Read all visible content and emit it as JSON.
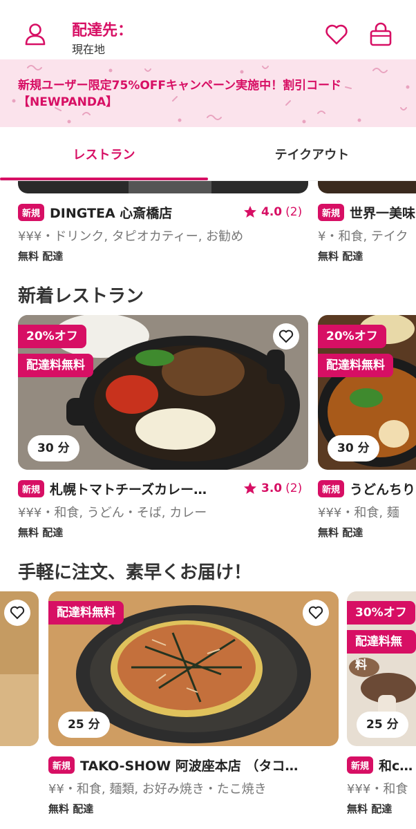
{
  "header": {
    "delivery_label": "配達先：",
    "location": "現在地",
    "icon_profile": "user-icon",
    "icon_favorites": "heart-icon",
    "icon_cart": "bag-icon"
  },
  "banner": {
    "line1": "新規ユーザー限定75%OFFキャンペーン実施中！割引コード",
    "line2": "【NEWPANDA】"
  },
  "tabs": {
    "restaurant": "レストラン",
    "takeout": "テイクアウト"
  },
  "brand_color": "#D70F64",
  "top_row": [
    {
      "new": "新規",
      "name": "DINGTEA 心斎橋店",
      "rating": "4.0",
      "count": "(2)",
      "meta": "¥¥¥・ドリンク, タピオカティー, お勧め",
      "fee": "無料 配達"
    },
    {
      "new": "新規",
      "name": "世界一美味",
      "meta": "¥・和食, テイク",
      "fee": "無料 配達"
    }
  ],
  "section_new": {
    "title": "新着レストラン",
    "cards": [
      {
        "discount": "20%オフ",
        "free_delivery": "配達料無料",
        "time": "30 分",
        "new": "新規",
        "name": "札幌トマトチーズカレー…",
        "rating": "3.0",
        "count": "(2)",
        "meta": "¥¥¥・和食, うどん・そば, カレー",
        "fee": "無料 配達"
      },
      {
        "discount": "20%オフ",
        "free_delivery": "配達料無料",
        "time": "30 分",
        "new": "新規",
        "name": "うどんちり",
        "meta": "¥¥¥・和食, 麺",
        "fee": "無料 配達"
      }
    ]
  },
  "section_quick": {
    "title": "手軽に注文、素早くお届け！",
    "cards": [
      {
        "free_delivery": "配達料無料",
        "time": "25 分",
        "new": "新規",
        "name": "TAKO-SHOW 阿波座本店 （タコ…",
        "meta": "¥¥・和食, 麺類, お好み焼き・たこ焼き",
        "fee": "無料 配達"
      },
      {
        "discount": "30%オフ",
        "free_delivery": "配達料無料",
        "time": "25 分",
        "new": "新規",
        "name": "和cafe",
        "meta": "¥¥¥・和食",
        "fee": "無料 配達"
      }
    ]
  }
}
